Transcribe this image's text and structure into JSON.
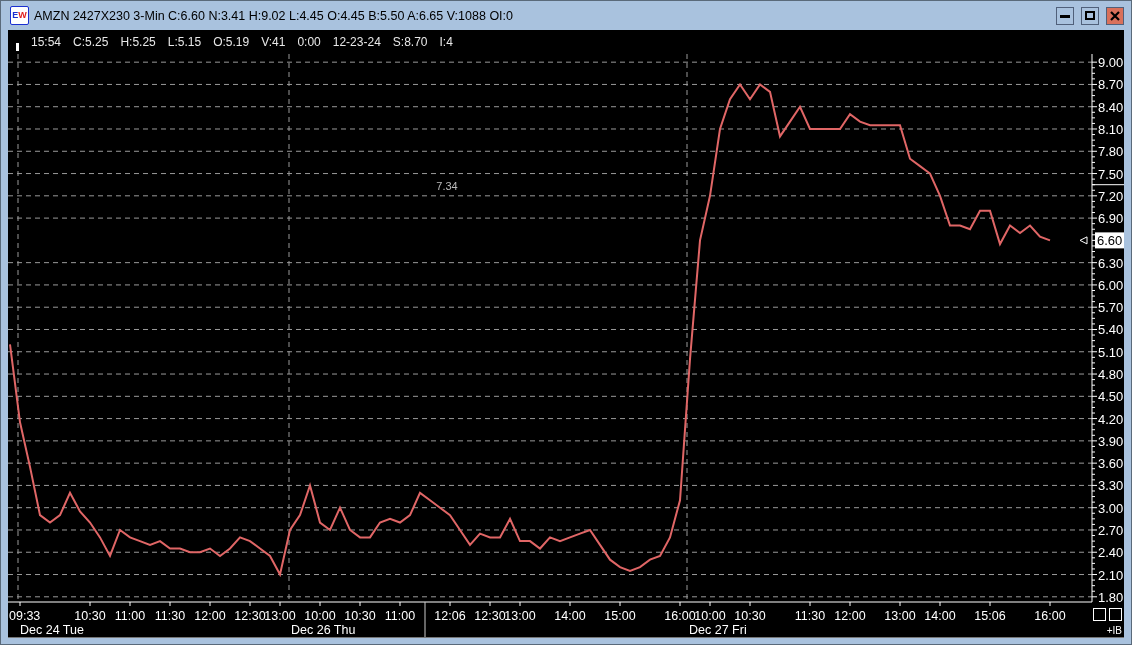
{
  "window": {
    "title": "AMZN 2427X230 3-Min C:6.60 N:3.41 H:9.02 L:4.45 O:4.45 B:5.50 A:6.65 V:1088 OI:0",
    "logo": [
      {
        "text": "E",
        "color": "#1a2fd0"
      },
      {
        "text": "W",
        "color": "#e0201e"
      }
    ]
  },
  "info_bar": [
    "15:54",
    "C:5.25",
    "H:5.25",
    "L:5.15",
    "O:5.19",
    "V:41",
    "0:00",
    "12-23-24",
    "S:8.70",
    "I:4"
  ],
  "chart": {
    "chart_data": {
      "type": "line",
      "categories": [
        null,
        "09:33",
        null,
        null,
        null,
        null,
        null,
        null,
        "10:30",
        null,
        null,
        null,
        "11:00",
        null,
        null,
        null,
        "11:30",
        null,
        null,
        null,
        "12:00",
        null,
        null,
        null,
        "12:30",
        null,
        null,
        "13:00",
        null,
        null,
        null,
        "10:00",
        null,
        null,
        null,
        "10:30",
        null,
        null,
        null,
        "11:00",
        null,
        null,
        null,
        null,
        "12:06",
        null,
        null,
        null,
        "12:30",
        null,
        null,
        "13:00",
        null,
        null,
        null,
        null,
        "14:00",
        null,
        null,
        null,
        null,
        "15:00",
        null,
        null,
        null,
        null,
        null,
        "16:00",
        null,
        null,
        "10:00",
        null,
        null,
        null,
        "10:30",
        null,
        null,
        null,
        null,
        null,
        "11:30",
        null,
        null,
        null,
        "12:00",
        null,
        null,
        null,
        null,
        "13:00",
        null,
        null,
        null,
        "14:00",
        null,
        null,
        null,
        null,
        "15:06",
        null,
        null,
        null,
        null,
        null,
        "16:00"
      ],
      "series": [
        {
          "color": "#e06666",
          "values": [
            5.2,
            4.15,
            3.55,
            2.9,
            2.8,
            2.9,
            3.2,
            2.95,
            2.8,
            2.6,
            2.35,
            2.7,
            2.6,
            2.55,
            2.5,
            2.55,
            2.45,
            2.45,
            2.4,
            2.4,
            2.45,
            2.35,
            2.45,
            2.6,
            2.55,
            2.45,
            2.35,
            2.1,
            2.7,
            2.9,
            3.3,
            2.8,
            2.7,
            3.0,
            2.7,
            2.6,
            2.6,
            2.8,
            2.85,
            2.8,
            2.9,
            3.2,
            3.1,
            3.0,
            2.9,
            2.7,
            2.5,
            2.65,
            2.6,
            2.6,
            2.85,
            2.55,
            2.55,
            2.45,
            2.6,
            2.55,
            2.6,
            2.65,
            2.7,
            2.5,
            2.3,
            2.2,
            2.15,
            2.2,
            2.3,
            2.35,
            2.6,
            3.1,
            5.0,
            6.6,
            7.2,
            8.1,
            8.5,
            8.7,
            8.5,
            8.7,
            8.6,
            8.0,
            8.2,
            8.4,
            8.1,
            8.1,
            8.1,
            8.1,
            8.3,
            8.2,
            8.15,
            8.15,
            8.15,
            8.15,
            7.7,
            7.6,
            7.5,
            7.2,
            6.8,
            6.8,
            6.75,
            7.0,
            7.0,
            6.55,
            6.8,
            6.7,
            6.8,
            6.65,
            6.6
          ]
        }
      ],
      "ylim": [
        1.73,
        9.11
      ],
      "grid": true,
      "yticks": [
        {
          "value": 9.0,
          "label": "9.00"
        },
        {
          "value": 8.7,
          "label": "8.70"
        },
        {
          "value": 8.4,
          "label": "8.40"
        },
        {
          "value": 8.1,
          "label": "8.10"
        },
        {
          "value": 7.8,
          "label": "7.80"
        },
        {
          "value": 7.5,
          "label": "7.50"
        },
        {
          "value": 7.2,
          "label": "7.20"
        },
        {
          "value": 6.9,
          "label": "6.90"
        },
        {
          "value": 6.3,
          "label": "6.30"
        },
        {
          "value": 6.0,
          "label": "6.00"
        },
        {
          "value": 5.7,
          "label": "5.70"
        },
        {
          "value": 5.4,
          "label": "5.40"
        },
        {
          "value": 5.1,
          "label": "5.10"
        },
        {
          "value": 4.8,
          "label": "4.80"
        },
        {
          "value": 4.5,
          "label": "4.50"
        },
        {
          "value": 4.2,
          "label": "4.20"
        },
        {
          "value": 3.9,
          "label": "3.90"
        },
        {
          "value": 3.6,
          "label": "3.60"
        },
        {
          "value": 3.3,
          "label": "3.30"
        },
        {
          "value": 3.0,
          "label": "3.00"
        },
        {
          "value": 2.7,
          "label": "2.70"
        },
        {
          "value": 2.4,
          "label": "2.40"
        },
        {
          "value": 2.1,
          "label": "2.10"
        },
        {
          "value": 1.8,
          "label": "1.80"
        }
      ],
      "annotations": [
        "7.34"
      ]
    },
    "sessions": [
      {
        "label": "Dec 24 Tue"
      },
      {
        "label": "Dec 26 Thu"
      },
      {
        "label": "Dec 27 Fri"
      }
    ],
    "last_price": "6.60"
  },
  "corner": {
    "label": "+IB"
  }
}
